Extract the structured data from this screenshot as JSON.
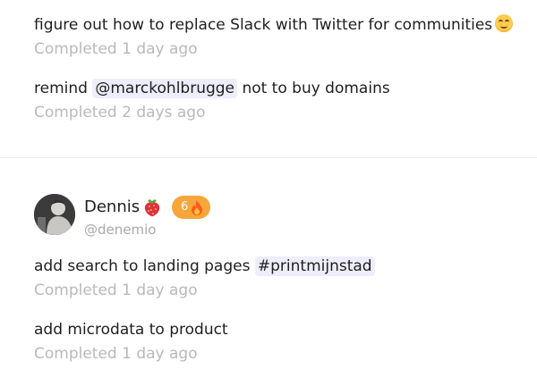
{
  "top_section": {
    "tasks": [
      {
        "text": "figure out how to replace Slack with Twitter for communities",
        "emoji": "upside-down-face",
        "status": "Completed 1 day ago"
      },
      {
        "prefix": "remind",
        "mention": "@marckohlbrugge",
        "suffix": "not to buy domains",
        "status": "Completed 2 days ago"
      }
    ]
  },
  "user": {
    "name": "Dennis",
    "name_emoji": "strawberry",
    "streak_count": "6",
    "streak_icon": "fire",
    "handle": "@denemio",
    "tasks": [
      {
        "text": "add search to landing pages",
        "hashtag": "#printmijnstad",
        "status": "Completed 1 day ago"
      },
      {
        "text": "add microdata to product",
        "status": "Completed 1 day ago"
      }
    ]
  },
  "colors": {
    "tag_background": "#eeedfb",
    "status_text": "#b9b9b9",
    "streak_badge": "#f7a73a",
    "divider": "#ececec"
  }
}
